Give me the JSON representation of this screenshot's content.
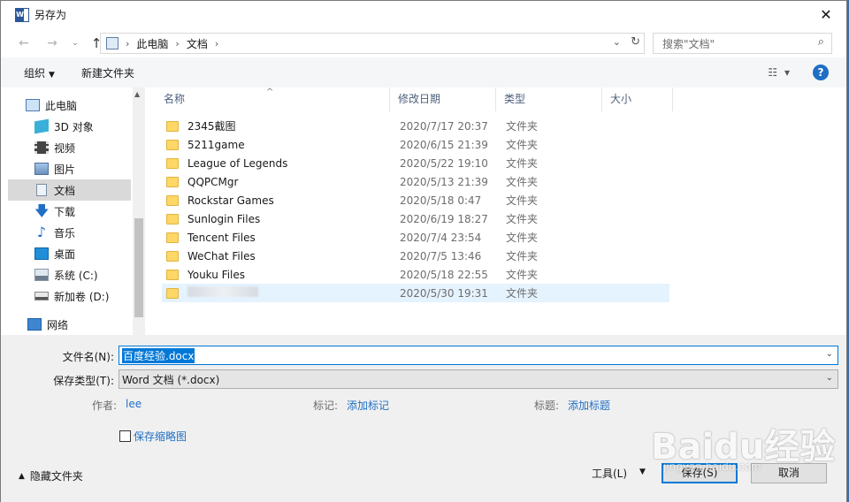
{
  "window": {
    "title": "另存为"
  },
  "nav": {
    "address_crumbs": [
      "此电脑",
      "文档"
    ],
    "search_placeholder": "搜索\"文档\""
  },
  "toolbar": {
    "organize": "组织",
    "new_folder": "新建文件夹"
  },
  "sidebar": {
    "items": [
      {
        "label": "此电脑",
        "icon": "computer-icon"
      },
      {
        "label": "3D 对象",
        "icon": "cube-3d-icon"
      },
      {
        "label": "视频",
        "icon": "video-icon"
      },
      {
        "label": "图片",
        "icon": "picture-icon"
      },
      {
        "label": "文档",
        "icon": "document-icon",
        "selected": true
      },
      {
        "label": "下载",
        "icon": "download-arrow-icon"
      },
      {
        "label": "音乐",
        "icon": "music-note-icon"
      },
      {
        "label": "桌面",
        "icon": "desktop-icon"
      },
      {
        "label": "系统 (C:)",
        "icon": "drive-icon"
      },
      {
        "label": "新加卷 (D:)",
        "icon": "drive-icon"
      },
      {
        "label": "网络",
        "icon": "network-icon"
      }
    ]
  },
  "filelist": {
    "columns": [
      "名称",
      "修改日期",
      "类型",
      "大小"
    ],
    "rows": [
      {
        "name": "2345截图",
        "date": "2020/7/17 20:37",
        "type": "文件夹"
      },
      {
        "name": "5211game",
        "date": "2020/6/15 21:39",
        "type": "文件夹"
      },
      {
        "name": "League of Legends",
        "date": "2020/5/22 19:10",
        "type": "文件夹"
      },
      {
        "name": "QQPCMgr",
        "date": "2020/5/13 21:39",
        "type": "文件夹"
      },
      {
        "name": "Rockstar Games",
        "date": "2020/5/18 0:47",
        "type": "文件夹"
      },
      {
        "name": "Sunlogin Files",
        "date": "2020/6/19 18:27",
        "type": "文件夹"
      },
      {
        "name": "Tencent Files",
        "date": "2020/7/4 23:54",
        "type": "文件夹"
      },
      {
        "name": "WeChat Files",
        "date": "2020/7/5 13:46",
        "type": "文件夹"
      },
      {
        "name": "Youku Files",
        "date": "2020/5/18 22:55",
        "type": "文件夹"
      },
      {
        "name": "",
        "date": "2020/5/30 19:31",
        "type": "文件夹",
        "blurred": true
      }
    ]
  },
  "form": {
    "filename_label": "文件名(N):",
    "filename_value": "百度经验.docx",
    "filetype_label": "保存类型(T):",
    "filetype_value": "Word 文档 (*.docx)",
    "author_label": "作者:",
    "author_value": "lee",
    "tags_label": "标记:",
    "tags_value": "添加标记",
    "title_label": "标题:",
    "title_value": "添加标题",
    "thumbnail_label": "保存缩略图"
  },
  "footer": {
    "hide_folders": "隐藏文件夹",
    "tools": "工具(L)",
    "save": "保存(S)",
    "cancel": "取消"
  },
  "watermark": {
    "word": "Baidu经验",
    "sub": "jingyan.baidu.com"
  },
  "colors": {
    "accent": "#0078d7",
    "link": "#1f6fc5",
    "folder": "#ffd766"
  }
}
